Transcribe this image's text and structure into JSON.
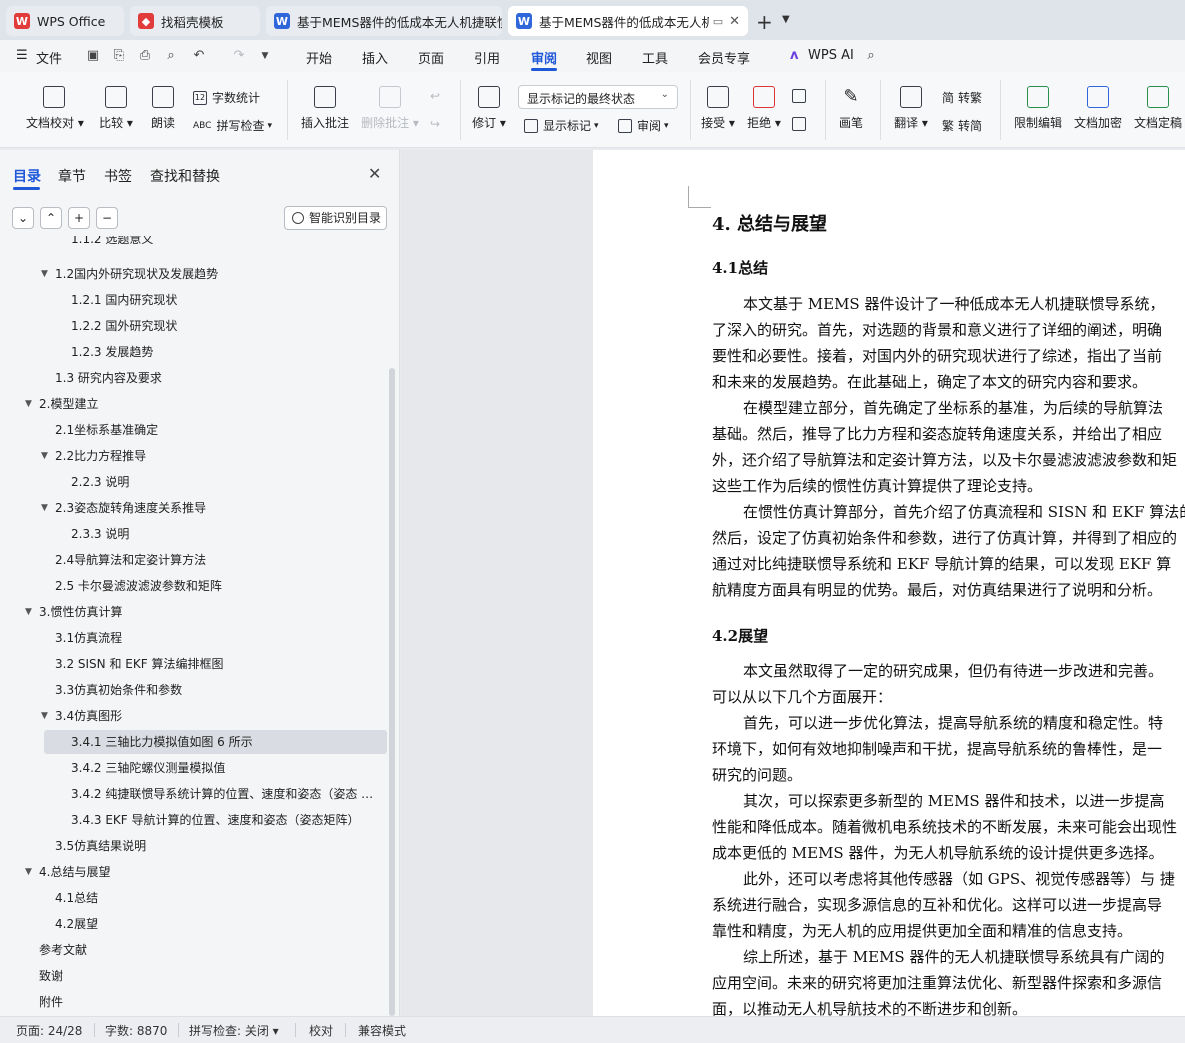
{
  "tabs": [
    {
      "label": "WPS Office",
      "icon": "wps-logo-icon",
      "color": "#e23b3b"
    },
    {
      "label": "找稻壳模板",
      "icon": "docer-icon",
      "color": "#e23b3b"
    },
    {
      "label": "基于MEMS器件的低成本无人机捷联惯",
      "icon": "word-doc-icon",
      "color": "#2f66d9"
    },
    {
      "label": "基于MEMS器件的低成本无人机",
      "icon": "word-doc-icon",
      "color": "#2f66d9"
    }
  ],
  "menu": {
    "file": "文件",
    "items": [
      "开始",
      "插入",
      "页面",
      "引用",
      "审阅",
      "视图",
      "工具",
      "会员专享"
    ],
    "active": "审阅",
    "ai": "WPS AI"
  },
  "ribbon": {
    "doc_check": "文档校对",
    "compare": "比较",
    "read_aloud": "朗读",
    "word_count": "字数统计",
    "spell_check": "拼写检查",
    "insert_comment": "插入批注",
    "delete_comment": "删除批注",
    "track_changes": "修订",
    "markup_combo": "显示标记的最终状态",
    "show_markup": "显示标记",
    "review_pane": "审阅",
    "accept": "接受",
    "reject": "拒绝",
    "pen": "画笔",
    "translate": "翻译",
    "to_traditional": "转繁",
    "to_simplified": "转简",
    "restrict_edit": "限制编辑",
    "encrypt": "文档加密",
    "finalize": "文档定稿"
  },
  "sidebar": {
    "tabs": [
      "目录",
      "章节",
      "书签",
      "查找和替换"
    ],
    "active_tab": "目录",
    "smart_button": "智能识别目录",
    "toc": [
      {
        "label": "1.1.2  选题意义",
        "level": 3,
        "arrow": ""
      },
      {
        "label": "1.2国内外研究现状及发展趋势",
        "level": 2,
        "arrow": "▼"
      },
      {
        "label": "1.2.1  国内研究现状",
        "level": 3,
        "arrow": ""
      },
      {
        "label": "1.2.2  国外研究现状",
        "level": 3,
        "arrow": ""
      },
      {
        "label": "1.2.3  发展趋势",
        "level": 3,
        "arrow": ""
      },
      {
        "label": "1.3 研究内容及要求",
        "level": 2,
        "arrow": ""
      },
      {
        "label": "2.模型建立",
        "level": 1,
        "arrow": "▼"
      },
      {
        "label": "2.1坐标系基准确定",
        "level": 2,
        "arrow": ""
      },
      {
        "label": "2.2比力方程推导",
        "level": 2,
        "arrow": "▼"
      },
      {
        "label": "2.2.3  说明",
        "level": 3,
        "arrow": ""
      },
      {
        "label": "2.3姿态旋转角速度关系推导",
        "level": 2,
        "arrow": "▼"
      },
      {
        "label": "2.3.3  说明",
        "level": 3,
        "arrow": ""
      },
      {
        "label": "2.4导航算法和定姿计算方法",
        "level": 2,
        "arrow": ""
      },
      {
        "label": "2.5 卡尔曼滤波滤波参数和矩阵",
        "level": 2,
        "arrow": ""
      },
      {
        "label": "3.惯性仿真计算",
        "level": 1,
        "arrow": "▼"
      },
      {
        "label": "3.1仿真流程",
        "level": 2,
        "arrow": ""
      },
      {
        "label": "3.2  SISN 和 EKF 算法编排框图",
        "level": 2,
        "arrow": ""
      },
      {
        "label": "3.3仿真初始条件和参数",
        "level": 2,
        "arrow": ""
      },
      {
        "label": "3.4仿真图形",
        "level": 2,
        "arrow": "▼"
      },
      {
        "label": "3.4.1  三轴比力模拟值如图 6 所示",
        "level": 3,
        "arrow": "",
        "selected": true
      },
      {
        "label": "3.4.2  三轴陀螺仪测量模拟值",
        "level": 3,
        "arrow": ""
      },
      {
        "label": "3.4.2  纯捷联惯导系统计算的位置、速度和姿态（姿态 …",
        "level": 3,
        "arrow": ""
      },
      {
        "label": "3.4.3 EKF 导航计算的位置、速度和姿态（姿态矩阵）",
        "level": 3,
        "arrow": ""
      },
      {
        "label": "3.5仿真结果说明",
        "level": 2,
        "arrow": ""
      },
      {
        "label": "4.总结与展望",
        "level": 1,
        "arrow": "▼"
      },
      {
        "label": "4.1总结",
        "level": 2,
        "arrow": ""
      },
      {
        "label": "4.2展望",
        "level": 2,
        "arrow": ""
      },
      {
        "label": "参考文献",
        "level": 1,
        "arrow": ""
      },
      {
        "label": "致谢",
        "level": 1,
        "arrow": ""
      },
      {
        "label": "附件",
        "level": 1,
        "arrow": ""
      }
    ]
  },
  "document": {
    "heading": "4.  总结与展望",
    "sec1": "4.1总结",
    "sec1_lines": [
      "本文基于 MEMS 器件设计了一种低成本无人机捷联惯导系统，",
      "了深入的研究。首先，对选题的背景和意义进行了详细的阐述，明确",
      "要性和必要性。接着，对国内外的研究现状进行了综述，指出了当前",
      "和未来的发展趋势。在此基础上，确定了本文的研究内容和要求。",
      "在模型建立部分，首先确定了坐标系的基准，为后续的导航算法",
      "基础。然后，推导了比力方程和姿态旋转角速度关系，并给出了相应",
      "外，还介绍了导航算法和定姿计算方法，以及卡尔曼滤波滤波参数和矩",
      "这些工作为后续的惯性仿真计算提供了理论支持。",
      "在惯性仿真计算部分，首先介绍了仿真流程和 SISN 和 EKF 算法的",
      "然后，设定了仿真初始条件和参数，进行了仿真计算，并得到了相应的",
      "通过对比纯捷联惯导系统和 EKF 导航计算的结果，可以发现 EKF 算",
      "航精度方面具有明显的优势。最后，对仿真结果进行了说明和分析。"
    ],
    "sec2": "4.2展望",
    "sec2_lines": [
      "本文虽然取得了一定的研究成果，但仍有待进一步改进和完善。",
      "可以从以下几个方面展开：",
      "首先，可以进一步优化算法，提高导航系统的精度和稳定性。特",
      "环境下，如何有效地抑制噪声和干扰，提高导航系统的鲁棒性，是一",
      "研究的问题。",
      "其次，可以探索更多新型的 MEMS 器件和技术，以进一步提高",
      "性能和降低成本。随着微机电系统技术的不断发展，未来可能会出现性",
      "成本更低的 MEMS 器件，为无人机导航系统的设计提供更多选择。",
      "此外，还可以考虑将其他传感器（如 GPS、视觉传感器等）与 捷",
      "系统进行融合，实现多源信息的互补和优化。这样可以进一步提高导",
      "靠性和精度，为无人机的应用提供更加全面和精准的信息支持。",
      "综上所述，基于 MEMS 器件的无人机捷联惯导系统具有广阔的",
      "应用空间。未来的研究将更加注重算法优化、新型器件探索和多源信",
      "面，以推动无人机导航技术的不断进步和创新。"
    ]
  },
  "status": {
    "page": "页面: 24/28",
    "words": "字数: 8870",
    "spell": "拼写检查: 关闭",
    "proof": "校对",
    "compat": "兼容模式"
  }
}
